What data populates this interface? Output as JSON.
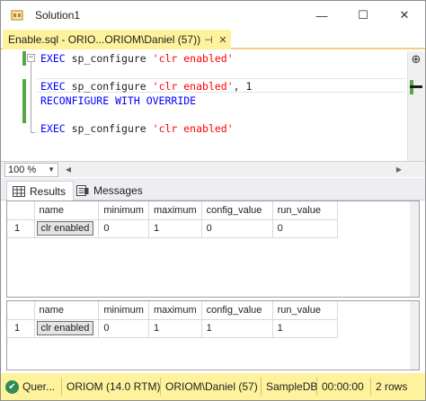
{
  "window": {
    "title": "Solution1",
    "buttons": {
      "minimize": "—",
      "maximize": "☐",
      "close": "✕"
    }
  },
  "document_tab": {
    "label": "Enable.sql - ORIO...ORIOM\\Daniel (57))",
    "pin_glyph": "⊣",
    "close_glyph": "✕"
  },
  "editor": {
    "lines": [
      [
        {
          "t": "EXEC",
          "c": "kw"
        },
        {
          "t": " sp_configure ",
          "c": "plain"
        },
        {
          "t": "'clr enabled'",
          "c": "str"
        }
      ],
      [],
      [
        {
          "t": "EXEC",
          "c": "kw"
        },
        {
          "t": " sp_configure ",
          "c": "plain"
        },
        {
          "t": "'clr enabled'",
          "c": "str"
        },
        {
          "t": ", 1",
          "c": "plain"
        }
      ],
      [
        {
          "t": "RECONFIGURE WITH OVERRIDE",
          "c": "kw"
        }
      ],
      [],
      [
        {
          "t": "EXEC",
          "c": "kw"
        },
        {
          "t": " sp_configure ",
          "c": "plain"
        },
        {
          "t": "'clr enabled'",
          "c": "str"
        }
      ]
    ],
    "collapse_glyph": "−",
    "split_glyph": "⊕"
  },
  "zoom": {
    "value": "100 %"
  },
  "results_tabs": [
    {
      "label": "Results",
      "active": true,
      "icon": "grid-icon"
    },
    {
      "label": "Messages",
      "active": false,
      "icon": "messages-icon"
    }
  ],
  "grids": [
    {
      "columns": [
        "name",
        "minimum",
        "maximum",
        "config_value",
        "run_value"
      ],
      "rows": [
        {
          "num": "1",
          "cells": [
            "clr enabled",
            "0",
            "1",
            "0",
            "0"
          ]
        }
      ]
    },
    {
      "columns": [
        "name",
        "minimum",
        "maximum",
        "config_value",
        "run_value"
      ],
      "rows": [
        {
          "num": "1",
          "cells": [
            "clr enabled",
            "0",
            "1",
            "1",
            "1"
          ]
        }
      ]
    }
  ],
  "status": {
    "query": "Quer...",
    "server": "ORIOM (14.0 RTM)",
    "user": "ORIOM\\Daniel (57)",
    "database": "SampleDB",
    "elapsed": "00:00:00",
    "rows": "2 rows"
  },
  "colors": {
    "tab_accent": "#fff29d",
    "keyword": "#0000ff",
    "string": "#ff0000",
    "change_bar": "#57a64a",
    "status_ok": "#2e8b57"
  }
}
